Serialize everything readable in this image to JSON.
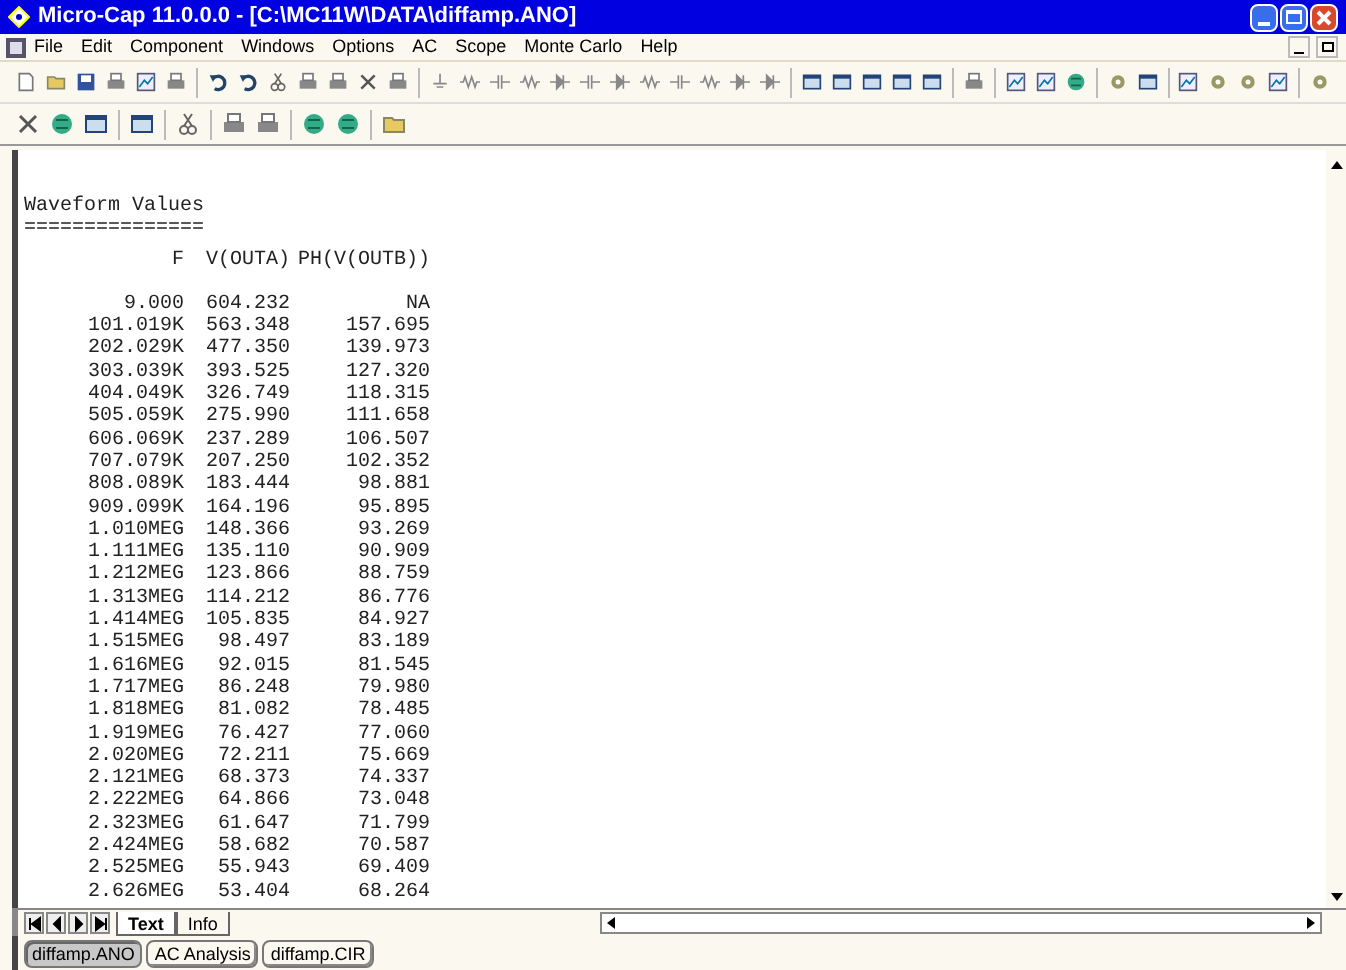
{
  "window": {
    "title": "Micro-Cap 11.0.0.0 - [C:\\MC11W\\DATA\\diffamp.ANO]"
  },
  "menu": [
    "File",
    "Edit",
    "Component",
    "Windows",
    "Options",
    "AC",
    "Scope",
    "Monte Carlo",
    "Help"
  ],
  "document": {
    "heading": "Waveform Values",
    "rule": "===============",
    "columns": [
      "F",
      "V(OUTA)",
      "PH(V(OUTB))"
    ],
    "rows": [
      [
        "9.000",
        "604.232",
        "NA"
      ],
      [
        "101.019K",
        "563.348",
        "157.695"
      ],
      [
        "202.029K",
        "477.350",
        "139.973"
      ],
      [
        "303.039K",
        "393.525",
        "127.320"
      ],
      [
        "404.049K",
        "326.749",
        "118.315"
      ],
      [
        "505.059K",
        "275.990",
        "111.658"
      ],
      [
        "606.069K",
        "237.289",
        "106.507"
      ],
      [
        "707.079K",
        "207.250",
        "102.352"
      ],
      [
        "808.089K",
        "183.444",
        "98.881"
      ],
      [
        "909.099K",
        "164.196",
        "95.895"
      ],
      [
        "1.010MEG",
        "148.366",
        "93.269"
      ],
      [
        "1.111MEG",
        "135.110",
        "90.909"
      ],
      [
        "1.212MEG",
        "123.866",
        "88.759"
      ],
      [
        "1.313MEG",
        "114.212",
        "86.776"
      ],
      [
        "1.414MEG",
        "105.835",
        "84.927"
      ],
      [
        "1.515MEG",
        "98.497",
        "83.189"
      ],
      [
        "1.616MEG",
        "92.015",
        "81.545"
      ],
      [
        "1.717MEG",
        "86.248",
        "79.980"
      ],
      [
        "1.818MEG",
        "81.082",
        "78.485"
      ],
      [
        "1.919MEG",
        "76.427",
        "77.060"
      ],
      [
        "2.020MEG",
        "72.211",
        "75.669"
      ],
      [
        "2.121MEG",
        "68.373",
        "74.337"
      ],
      [
        "2.222MEG",
        "64.866",
        "73.048"
      ],
      [
        "2.323MEG",
        "61.647",
        "71.799"
      ],
      [
        "2.424MEG",
        "58.682",
        "70.587"
      ],
      [
        "2.525MEG",
        "55.943",
        "69.409"
      ],
      [
        "2.626MEG",
        "53.404",
        "68.264"
      ]
    ]
  },
  "sheet_tabs": [
    {
      "label": "Text",
      "selected": true
    },
    {
      "label": "Info",
      "selected": false
    }
  ],
  "file_tabs": [
    {
      "label": "diffamp.ANO",
      "selected": true
    },
    {
      "label": "AC Analysis",
      "selected": false
    },
    {
      "label": "diffamp.CIR",
      "selected": false
    }
  ]
}
